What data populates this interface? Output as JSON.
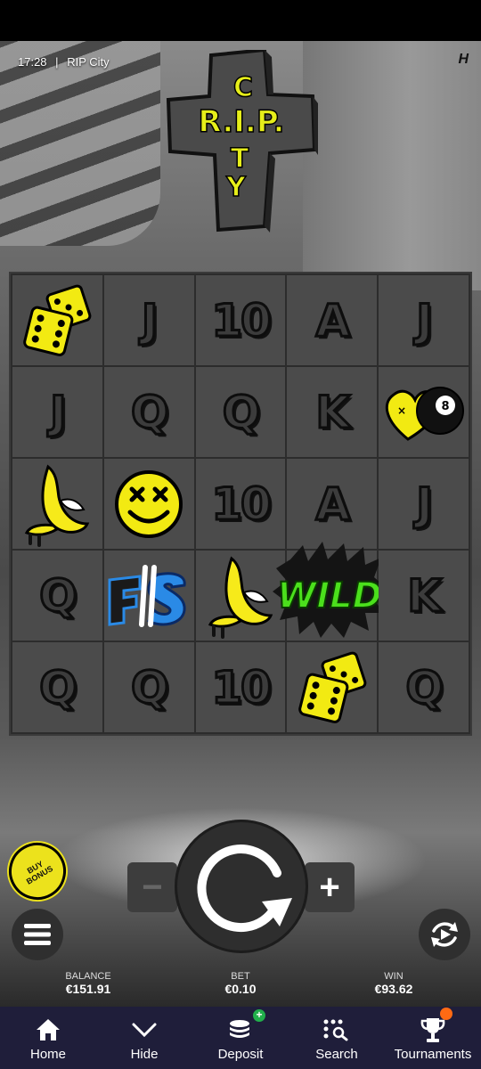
{
  "status": {
    "time": "17:28",
    "separator": "|",
    "game_name": "RIP City"
  },
  "brand_mark": "H",
  "logo": {
    "word1": "R.I.P.",
    "word2": "CITY"
  },
  "grid": [
    [
      "dice",
      "J",
      "10",
      "A",
      "J"
    ],
    [
      "J",
      "Q",
      "Q",
      "K",
      "heart-8ball"
    ],
    [
      "banana",
      "smiley",
      "10",
      "A",
      "J"
    ],
    [
      "Q",
      "FS",
      "banana",
      "WILD",
      "K"
    ],
    [
      "Q",
      "Q",
      "10",
      "dice",
      "Q"
    ]
  ],
  "buy_bonus": {
    "line1": "BUY",
    "line2": "BONUS"
  },
  "controls": {
    "minus": "−",
    "plus": "+"
  },
  "stats": {
    "balance_label": "BALANCE",
    "balance_value": "€151.91",
    "bet_label": "BET",
    "bet_value": "€0.10",
    "win_label": "WIN",
    "win_value": "€93.62"
  },
  "nav": {
    "home": "Home",
    "hide": "Hide",
    "deposit": "Deposit",
    "search": "Search",
    "tournaments": "Tournaments",
    "deposit_badge": "+"
  },
  "colors": {
    "accent_yellow": "#ece21c",
    "wild_green": "#4be01c",
    "nav_bg": "#1f1e3a",
    "badge_orange": "#ff6a13"
  }
}
